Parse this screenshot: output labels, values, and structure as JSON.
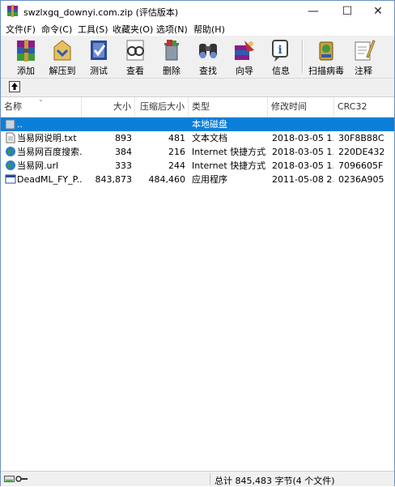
{
  "window": {
    "title": "swzlxgq_downyi.com.zip (评估版本)",
    "controls": {
      "minimize": "—",
      "maximize": "☐",
      "close": "✕"
    }
  },
  "menu": [
    {
      "label": "文件(F)"
    },
    {
      "label": "命令(C)"
    },
    {
      "label": "工具(S)"
    },
    {
      "label": "收藏夹(O)"
    },
    {
      "label": "选项(N)"
    },
    {
      "label": "帮助(H)"
    }
  ],
  "toolbar": [
    {
      "label": "添加",
      "icon": "add-icon"
    },
    {
      "label": "解压到",
      "icon": "extract-icon"
    },
    {
      "label": "测试",
      "icon": "test-icon"
    },
    {
      "label": "查看",
      "icon": "view-icon"
    },
    {
      "label": "删除",
      "icon": "delete-icon"
    },
    {
      "label": "查找",
      "icon": "find-icon"
    },
    {
      "label": "向导",
      "icon": "wizard-icon"
    },
    {
      "label": "信息",
      "icon": "info-icon"
    },
    {
      "label": "扫描病毒",
      "icon": "virus-scan-icon"
    },
    {
      "label": "注释",
      "icon": "comment-icon"
    }
  ],
  "columns": {
    "name": "名称",
    "size": "大小",
    "packed": "压缩后大小",
    "type": "类型",
    "modified": "修改时间",
    "crc": "CRC32"
  },
  "rows": [
    {
      "name": "..",
      "size": "",
      "packed": "",
      "type": "本地磁盘",
      "modified": "",
      "crc": "",
      "icon": "folder-up-icon",
      "selected": true
    },
    {
      "name": "当易网说明.txt",
      "size": "893",
      "packed": "481",
      "type": "文本文档",
      "modified": "2018-03-05 1...",
      "crc": "30F8B88C",
      "icon": "text-file-icon",
      "selected": false
    },
    {
      "name": "当易网百度搜索...",
      "size": "384",
      "packed": "216",
      "type": "Internet 快捷方式",
      "modified": "2018-03-05 1...",
      "crc": "220DE432",
      "icon": "internet-shortcut-icon",
      "selected": false
    },
    {
      "name": "当易网.url",
      "size": "333",
      "packed": "244",
      "type": "Internet 快捷方式",
      "modified": "2018-03-05 1...",
      "crc": "7096605F",
      "icon": "internet-shortcut-icon",
      "selected": false
    },
    {
      "name": "DeadML_FY_P...",
      "size": "843,873",
      "packed": "484,460",
      "type": "应用程序",
      "modified": "2011-05-08 2...",
      "crc": "0236A905",
      "icon": "application-icon",
      "selected": false
    }
  ],
  "status": {
    "summary": "总计 845,483 字节(4 个文件)"
  },
  "colors": {
    "selection": "#0a7fd8",
    "window_border": "#6b8fbf"
  }
}
